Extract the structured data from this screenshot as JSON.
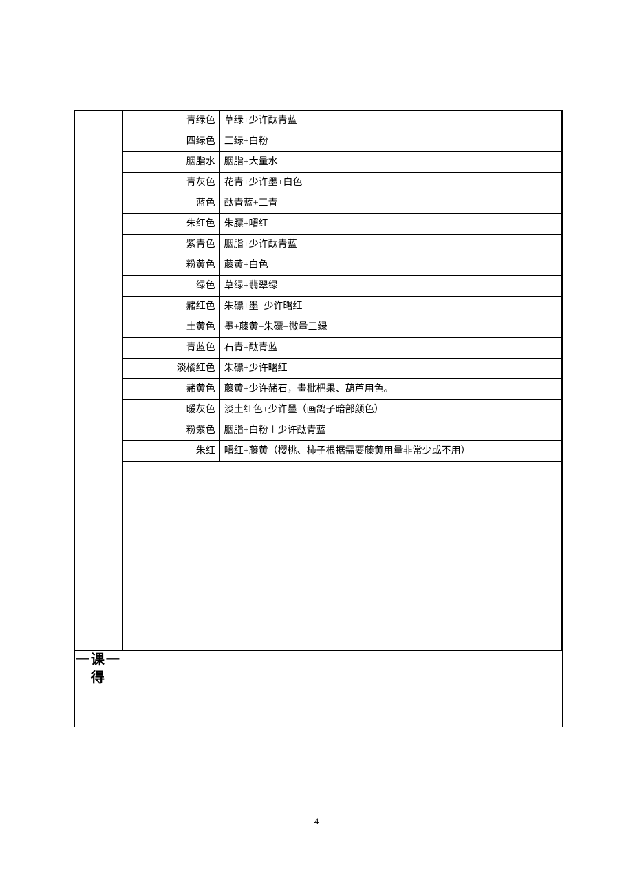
{
  "rows": [
    {
      "name": "青绿色",
      "mix": "草绿+少许酞青蓝"
    },
    {
      "name": "四绿色",
      "mix": "三绿+白粉"
    },
    {
      "name": "胭脂水",
      "mix": "胭脂+大量水"
    },
    {
      "name": "青灰色",
      "mix": "花青+少许墨+白色"
    },
    {
      "name": "蓝色",
      "mix": "酞青蓝+三青"
    },
    {
      "name": "朱红色",
      "mix": "朱膘+曙红"
    },
    {
      "name": "紫青色",
      "mix": "胭脂+少许酞青蓝"
    },
    {
      "name": "粉黄色",
      "mix": "藤黄+白色"
    },
    {
      "name": "绿色",
      "mix": "草绿+翡翠绿"
    },
    {
      "name": "赭红色",
      "mix": "朱磦+墨+少许曙红"
    },
    {
      "name": "土黄色",
      "mix": "墨+藤黄+朱磦+微量三绿"
    },
    {
      "name": "青蓝色",
      "mix": "石青+酞青蓝"
    },
    {
      "name": "淡橘红色",
      "mix": "朱磦+少许曙红"
    },
    {
      "name": "赭黄色",
      "mix": "藤黄+少许赭石，畫枇杷果、葫芦用色。"
    },
    {
      "name": "暖灰色",
      "mix": "淡土红色+少许墨（画鸽子暗部颜色）"
    },
    {
      "name": "粉紫色",
      "mix": "胭脂+白粉＋少许酞青蓝"
    },
    {
      "name": "朱红",
      "mix": "曙红+藤黄（樱桃、柿子根据需要藤黄用量非常少或不用）"
    }
  ],
  "section_label": "一课一得",
  "page_number": "4"
}
